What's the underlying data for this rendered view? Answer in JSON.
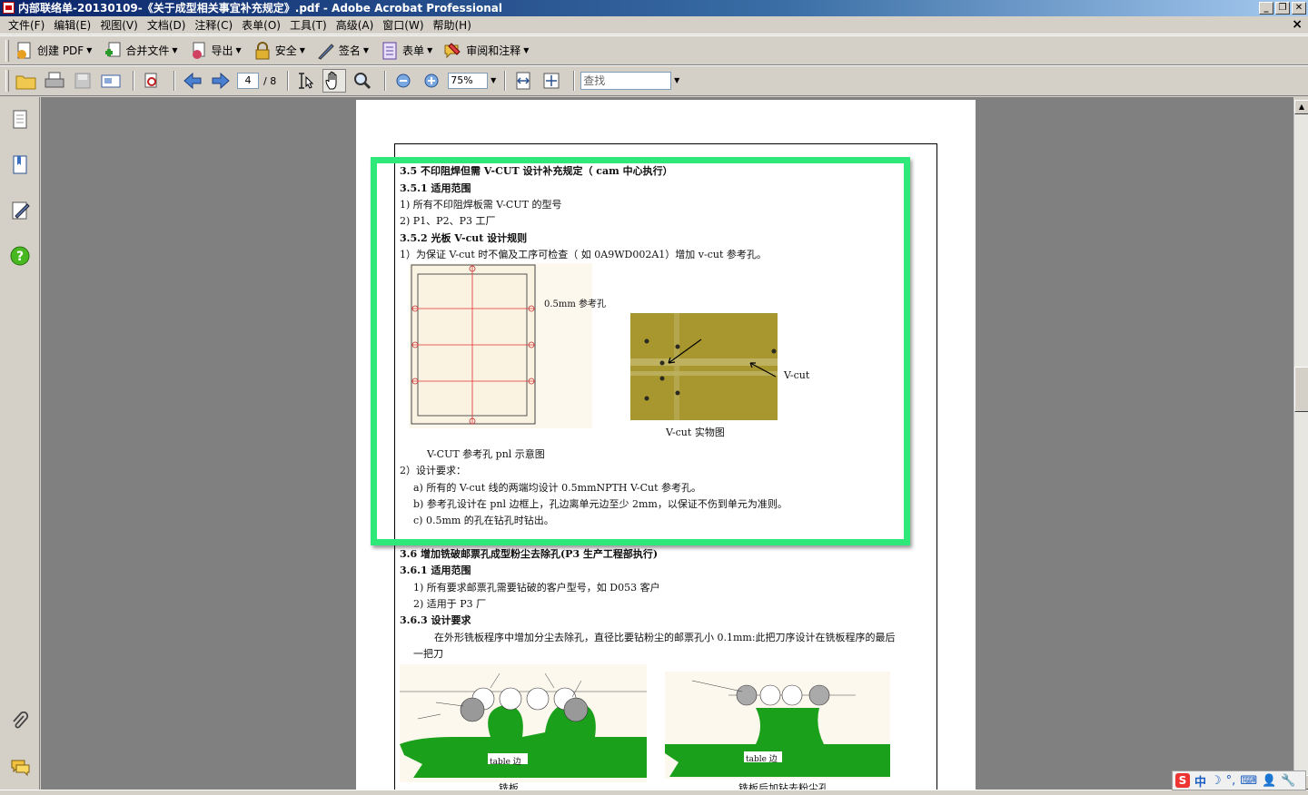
{
  "window": {
    "title": "内部联络单-20130109-《关于成型相关事宜补充规定》.pdf - Adobe Acrobat Professional"
  },
  "menu": [
    "文件(F)",
    "编辑(E)",
    "视图(V)",
    "文档(D)",
    "注释(C)",
    "表单(O)",
    "工具(T)",
    "高级(A)",
    "窗口(W)",
    "帮助(H)"
  ],
  "toolbar_tasks": [
    {
      "label": "创建 PDF",
      "icon": "create-pdf-icon"
    },
    {
      "label": "合并文件",
      "icon": "combine-files-icon"
    },
    {
      "label": "导出",
      "icon": "export-icon"
    },
    {
      "label": "安全",
      "icon": "lock-icon"
    },
    {
      "label": "签名",
      "icon": "pen-icon"
    },
    {
      "label": "表单",
      "icon": "form-icon"
    },
    {
      "label": "审阅和注释",
      "icon": "comment-icon"
    }
  ],
  "navigation": {
    "current_page": "4",
    "total_pages": "/ 8",
    "zoom": "75%",
    "find_placeholder": "查找"
  },
  "document": {
    "s35_title": "3.5 不印阻焊但需 V-CUT 设计补充规定（ cam 中心执行）",
    "s351_title": "3.5.1   适用范围",
    "s351_1": "1) 所有不印阻焊板需 V-CUT 的型号",
    "s351_2": "2) P1、P2、P3 工厂",
    "s352_title": "3.5.2   光板 V-cut 设计规则",
    "s352_1": "1）为保证 V-cut 时不偏及工序可检查（ 如 0A9WD002A1）增加 v-cut 参考孔。",
    "fig1_label": "0.5mm 参考孔",
    "fig1_caption": "V-CUT 参考孔 pnl 示意图",
    "fig2_label": "V-cut",
    "fig2_caption": "V-cut 实物图",
    "s352_2": "2）设计要求：",
    "req_a": "a)  所有的 V-cut 线的两端均设计 0.5mmNPTH V-Cut 参考孔。",
    "req_b": "b)  参考孔设计在 pnl 边框上，孔边离单元边至少 2mm，以保证不伤到单元为准则。",
    "req_c": "c)  0.5mm 的孔在钻孔时钻出。",
    "s36_title": "3.6 增加铣破邮票孔成型粉尘去除孔(P3 生产工程部执行)",
    "s361_title": "3.6.1 适用范围",
    "s361_1": "1) 所有要求邮票孔需要钻破的客户型号，如 D053 客户",
    "s361_2": "2) 适用于 P3 厂",
    "s363_title": "3.6.3 设计要求",
    "s363_body_1": "在外形铣板程序中增加分尘去除孔，直径比要钻粉尘的邮票孔小 0.1mm:此把刀序设计在铣板程序的最后",
    "s363_body_2": "一把刀",
    "fig3_label": "table 边",
    "fig3_caption": "铣板",
    "fig4_label": "table 边",
    "fig4_caption": "铣板后加钻去粉尘孔"
  },
  "ime": {
    "lang": "中",
    "icon": "sogou-icon"
  },
  "colors": {
    "highlight": "#2ee87a",
    "pcb_green": "#1aa01a"
  }
}
